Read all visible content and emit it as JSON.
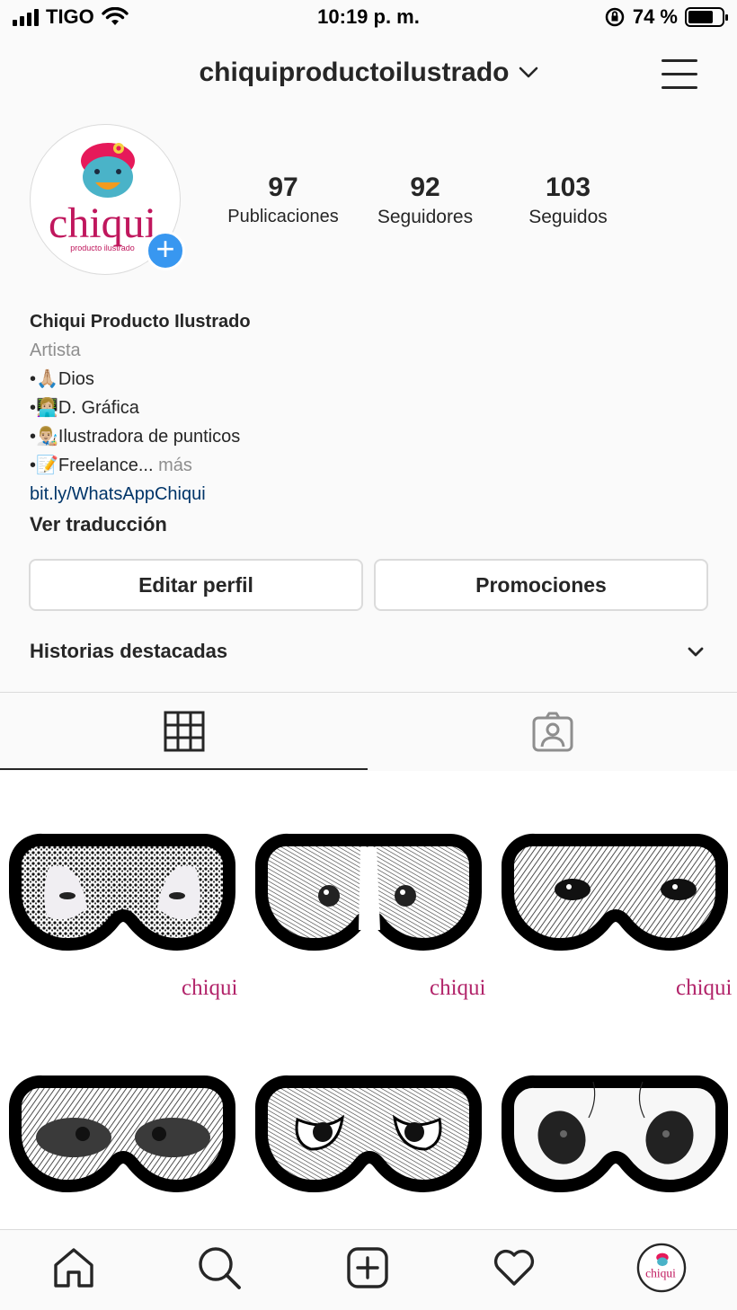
{
  "status_bar": {
    "carrier": "TIGO",
    "time": "10:19 p. m.",
    "battery_percent": "74 %",
    "battery_level": 0.74
  },
  "header": {
    "username": "chiquiproductoilustrado"
  },
  "avatar": {
    "logo_text": "chiqui",
    "logo_sub": "producto ilustrado",
    "add_symbol": "+"
  },
  "stats": [
    {
      "value": "97",
      "label": "Publicaciones"
    },
    {
      "value": "92",
      "label": "Seguidores"
    },
    {
      "value": "103",
      "label": "Seguidos"
    }
  ],
  "bio": {
    "name": "Chiqui Producto Ilustrado",
    "category": "Artista",
    "lines": [
      "•🙏🏼Dios",
      "•👩🏼‍💻D. Gráfica",
      "•👨🏼‍🎨Ilustradora de punticos",
      "•📝Freelance..."
    ],
    "more": "más",
    "link": "bit.ly/WhatsAppChiqui",
    "translate": "Ver traducción"
  },
  "buttons": {
    "edit_profile": "Editar perfil",
    "promotions": "Promociones"
  },
  "highlights": {
    "title": "Historias destacadas"
  },
  "grid": {
    "watermark": "chiqui",
    "watermark_sub": "producto ilustrado",
    "posts": [
      "penguin-mask",
      "dog-mask",
      "cat-mask",
      "monkey-mask",
      "owl-mask",
      "panda-mask"
    ]
  },
  "colors": {
    "accent_blue": "#3897f0",
    "brand_magenta": "#b2246a",
    "link_blue": "#003569",
    "muted": "#8e8e8e"
  },
  "bottom_nav": [
    "home-icon",
    "search-icon",
    "new-post-icon",
    "activity-heart-icon",
    "profile-avatar"
  ]
}
